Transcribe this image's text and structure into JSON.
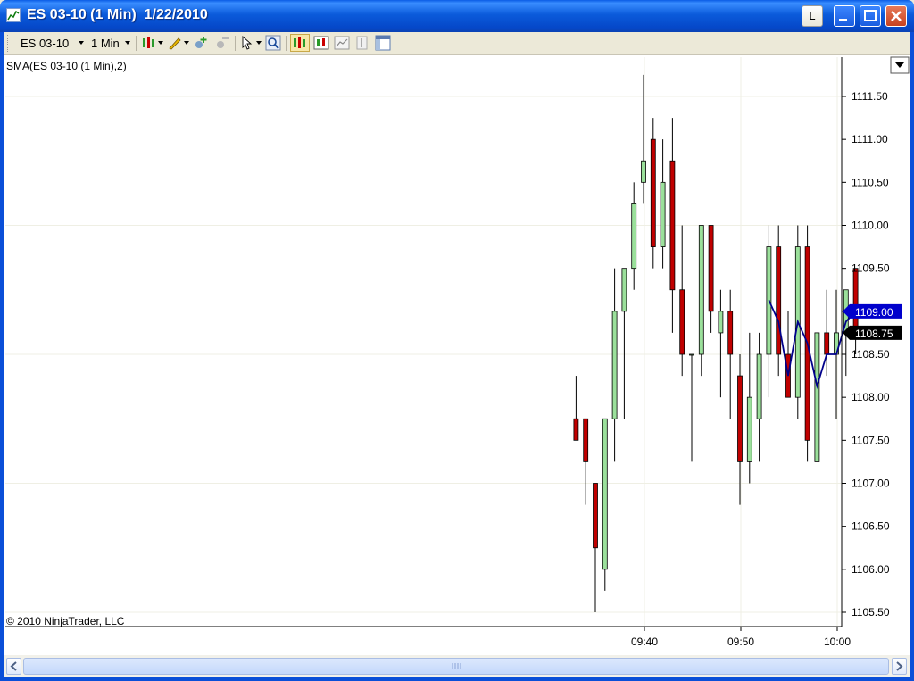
{
  "window": {
    "title": "ES 03-10 (1 Min)  1/22/2010",
    "button_l": "L"
  },
  "toolbar": {
    "instrument": "ES 03-10",
    "interval": "1 Min"
  },
  "indicator_label": "SMA(ES 03-10 (1 Min),2)",
  "copyright": "© 2010 NinjaTrader, LLC",
  "colors": {
    "up": "#9BE09B",
    "down": "#C00000",
    "sma": "#00008B",
    "grid": "#EFEFE4",
    "price_tag_sma": "#0000CC",
    "price_tag_last": "#000000"
  },
  "chart_data": {
    "type": "candlestick",
    "y_ticks": [
      "1105.50",
      "1106.00",
      "1106.50",
      "1107.00",
      "1107.50",
      "1108.00",
      "1108.50",
      "1109.00",
      "1109.50",
      "1110.00",
      "1110.50",
      "1111.00",
      "1111.50"
    ],
    "x_ticks": [
      "09:40",
      "09:50",
      "10:00"
    ],
    "ylim": [
      1105.25,
      1111.75
    ],
    "start_minute": 573,
    "end_minute": 600,
    "candles": [
      {
        "o": 1107.75,
        "h": 1108.25,
        "l": 1107.5,
        "c": 1107.5
      },
      {
        "o": 1107.75,
        "h": 1107.75,
        "l": 1106.75,
        "c": 1107.25
      },
      {
        "o": 1107.0,
        "h": 1107.0,
        "l": 1105.5,
        "c": 1106.25
      },
      {
        "o": 1106.0,
        "h": 1107.75,
        "l": 1105.75,
        "c": 1107.75
      },
      {
        "o": 1107.75,
        "h": 1109.5,
        "l": 1107.25,
        "c": 1109.0
      },
      {
        "o": 1109.0,
        "h": 1109.5,
        "l": 1107.75,
        "c": 1109.5
      },
      {
        "o": 1109.5,
        "h": 1110.5,
        "l": 1109.25,
        "c": 1110.25
      },
      {
        "o": 1110.5,
        "h": 1111.75,
        "l": 1110.25,
        "c": 1110.75
      },
      {
        "o": 1111.0,
        "h": 1111.25,
        "l": 1109.5,
        "c": 1109.75
      },
      {
        "o": 1109.75,
        "h": 1111.0,
        "l": 1109.5,
        "c": 1110.5
      },
      {
        "o": 1110.75,
        "h": 1111.25,
        "l": 1108.75,
        "c": 1109.25
      },
      {
        "o": 1109.25,
        "h": 1110.0,
        "l": 1108.25,
        "c": 1108.5
      },
      {
        "o": 1108.5,
        "h": 1108.5,
        "l": 1107.25,
        "c": 1108.5
      },
      {
        "o": 1108.5,
        "h": 1110.0,
        "l": 1108.25,
        "c": 1110.0
      },
      {
        "o": 1110.0,
        "h": 1110.0,
        "l": 1108.75,
        "c": 1109.0
      },
      {
        "o": 1108.75,
        "h": 1109.25,
        "l": 1108.0,
        "c": 1109.0
      },
      {
        "o": 1109.0,
        "h": 1109.25,
        "l": 1107.75,
        "c": 1108.5
      },
      {
        "o": 1108.25,
        "h": 1108.5,
        "l": 1106.75,
        "c": 1107.25
      },
      {
        "o": 1107.25,
        "h": 1108.75,
        "l": 1107.0,
        "c": 1108.0
      },
      {
        "o": 1107.75,
        "h": 1108.75,
        "l": 1107.25,
        "c": 1108.5
      },
      {
        "o": 1108.5,
        "h": 1110.0,
        "l": 1108.0,
        "c": 1109.75
      },
      {
        "o": 1109.75,
        "h": 1110.0,
        "l": 1108.25,
        "c": 1108.5
      },
      {
        "o": 1108.5,
        "h": 1109.0,
        "l": 1108.0,
        "c": 1108.0
      },
      {
        "o": 1108.0,
        "h": 1110.0,
        "l": 1107.75,
        "c": 1109.75
      },
      {
        "o": 1109.75,
        "h": 1110.0,
        "l": 1107.25,
        "c": 1107.5
      },
      {
        "o": 1107.25,
        "h": 1108.75,
        "l": 1107.25,
        "c": 1108.75
      },
      {
        "o": 1108.75,
        "h": 1109.25,
        "l": 1108.25,
        "c": 1108.5
      },
      {
        "o": 1108.5,
        "h": 1109.25,
        "l": 1107.75,
        "c": 1108.75
      },
      {
        "o": 1108.75,
        "h": 1109.25,
        "l": 1108.25,
        "c": 1109.25
      },
      {
        "o": 1109.5,
        "h": 1109.5,
        "l": 1108.5,
        "c": 1108.75
      }
    ],
    "sma": [
      {
        "i": 20,
        "v": 1109.13
      },
      {
        "i": 21,
        "v": 1108.88
      },
      {
        "i": 22,
        "v": 1108.25
      },
      {
        "i": 23,
        "v": 1108.88
      },
      {
        "i": 24,
        "v": 1108.63
      },
      {
        "i": 25,
        "v": 1108.13
      },
      {
        "i": 26,
        "v": 1108.5
      },
      {
        "i": 27,
        "v": 1108.5
      },
      {
        "i": 28,
        "v": 1108.88
      },
      {
        "i": 29,
        "v": 1109.0
      }
    ],
    "price_tags": [
      {
        "label": "1109.00",
        "value": 1109.0,
        "kind": "sma"
      },
      {
        "label": "1108.75",
        "value": 1108.75,
        "kind": "last"
      }
    ]
  }
}
